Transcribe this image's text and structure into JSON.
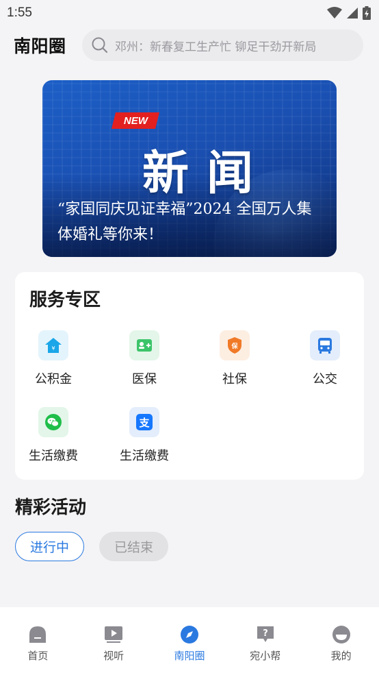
{
  "status_bar": {
    "time": "1:55"
  },
  "header": {
    "title": "南阳圈",
    "search_placeholder": "邓州：新春复工生产忙  铆足干劲开新局"
  },
  "banner": {
    "badge": "NEW",
    "big_text": "新闻",
    "caption": "“家国同庆见证幸福”2024 全国万人集体婚礼等你来！"
  },
  "services": {
    "title": "服务专区",
    "items": [
      {
        "label": "公积金",
        "icon": "housing-fund-icon",
        "color": "#1aa6e8",
        "bg": "#e4f4fc"
      },
      {
        "label": "医保",
        "icon": "medical-insurance-icon",
        "color": "#3cc46a",
        "bg": "#e3f6e9"
      },
      {
        "label": "社保",
        "icon": "social-security-icon",
        "color": "#f07a28",
        "bg": "#fdeee2"
      },
      {
        "label": "公交",
        "icon": "bus-icon",
        "color": "#2a79e0",
        "bg": "#e3edfb"
      },
      {
        "label": "生活缴费",
        "icon": "wechat-icon",
        "color": "#1fbe4a",
        "bg": "#e3f6e9"
      },
      {
        "label": "生活缴费",
        "icon": "alipay-icon",
        "color": "#1677ff",
        "bg": "#e3edfb"
      }
    ]
  },
  "activities": {
    "title": "精彩活动",
    "tabs": [
      {
        "label": "进行中",
        "active": true
      },
      {
        "label": "已结束",
        "active": false
      }
    ]
  },
  "bottom_nav": {
    "items": [
      {
        "label": "首页",
        "icon": "home-icon",
        "active": false
      },
      {
        "label": "视听",
        "icon": "video-icon",
        "active": false
      },
      {
        "label": "南阳圈",
        "icon": "compass-icon",
        "active": true
      },
      {
        "label": "宛小帮",
        "icon": "help-icon",
        "active": false
      },
      {
        "label": "我的",
        "icon": "profile-icon",
        "active": false
      }
    ]
  }
}
